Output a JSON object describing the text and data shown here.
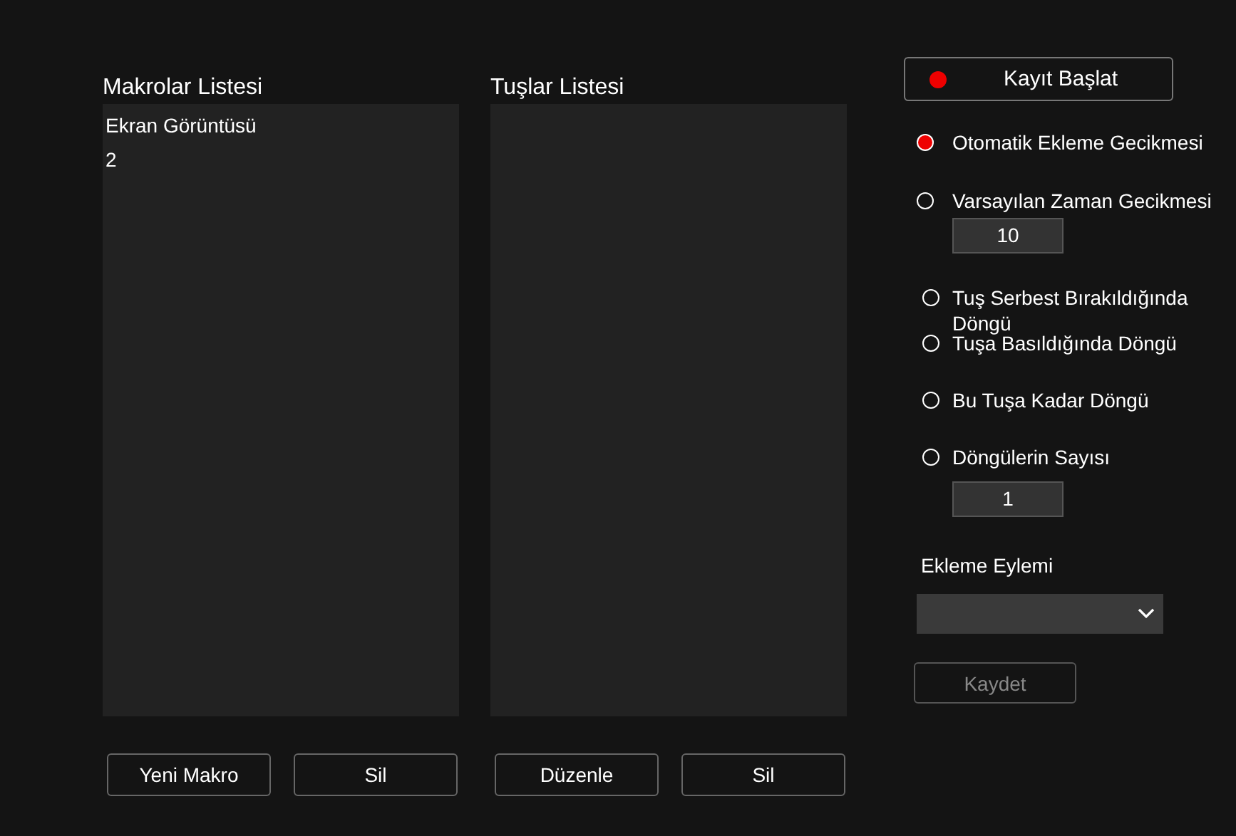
{
  "macros": {
    "title": "Makrolar Listesi",
    "items": [
      {
        "label": "Ekran Görüntüsü"
      },
      {
        "label": "2"
      }
    ]
  },
  "keys": {
    "title": "Tuşlar Listesi"
  },
  "left_buttons": [
    "Yeni Makro",
    "Sil"
  ],
  "mid_buttons": [
    "Düzenle",
    "Sil"
  ],
  "record_button": "Kayıt Başlat",
  "delay_options": [
    {
      "label": "Otomatik Ekleme Gecikmesi",
      "selected": true
    },
    {
      "label": "Varsayılan Zaman Gecikmesi",
      "selected": false,
      "value": "10"
    }
  ],
  "loop_options": [
    {
      "label": "Tuş Serbest Bırakıldığında Döngü",
      "selected": false
    },
    {
      "label": "Tuşa Basıldığında Döngü",
      "selected": false
    },
    {
      "label": "Bu Tuşa Kadar Döngü",
      "selected": false
    },
    {
      "label": "Döngülerin Sayısı",
      "selected": false,
      "value": "1"
    }
  ],
  "action": {
    "label": "Ekleme Eylemi"
  },
  "save_button": {
    "label": "Kaydet",
    "disabled": true
  }
}
